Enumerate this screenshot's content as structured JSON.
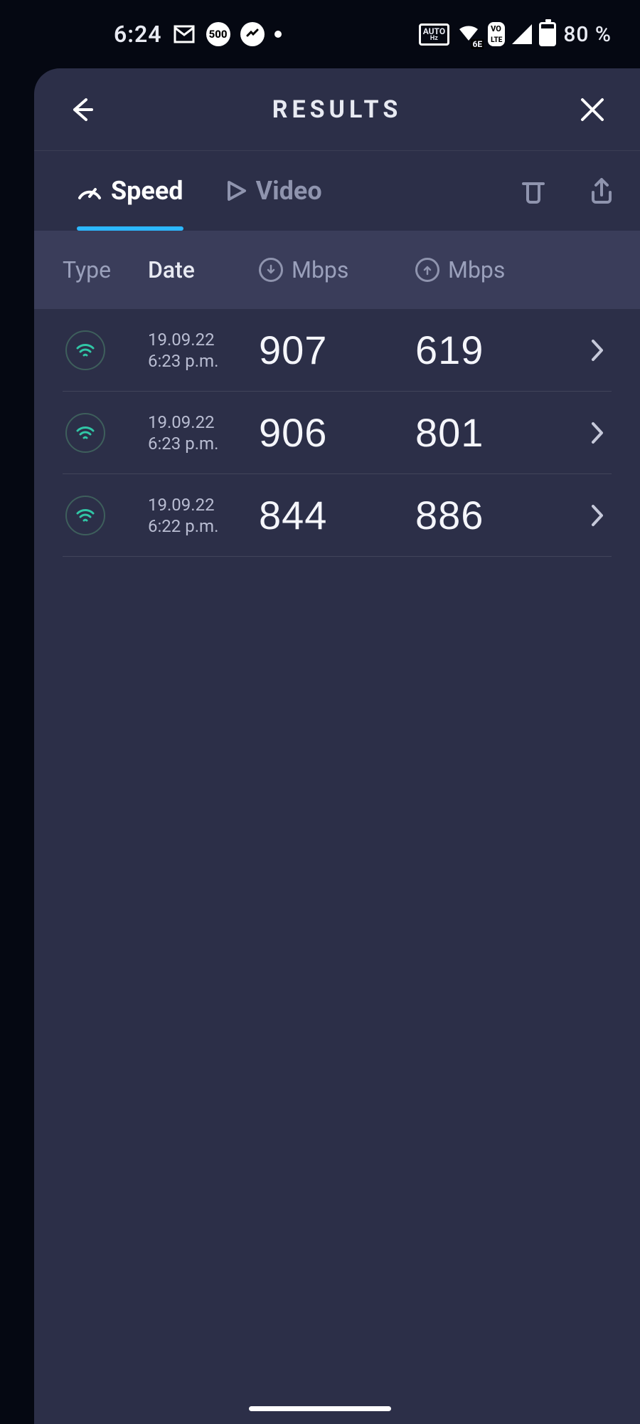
{
  "status_bar": {
    "time": "6:24",
    "icons": {
      "gmail": "M",
      "app_pill": "500",
      "messenger": "messenger",
      "notification_dot": true,
      "auto_hz_top": "AUTO",
      "auto_hz_bottom": "Hz",
      "wifi6e": "6E",
      "volte": "LTE"
    },
    "battery_percent": "80 %"
  },
  "header": {
    "title": "RESULTS"
  },
  "tabs": {
    "speed": "Speed",
    "video": "Video"
  },
  "columns": {
    "type": "Type",
    "date": "Date",
    "down_unit": "Mbps",
    "up_unit": "Mbps"
  },
  "results": [
    {
      "date": "19.09.22",
      "time": "6:23 p.m.",
      "download": "907",
      "upload": "619"
    },
    {
      "date": "19.09.22",
      "time": "6:23 p.m.",
      "download": "906",
      "upload": "801"
    },
    {
      "date": "19.09.22",
      "time": "6:22 p.m.",
      "download": "844",
      "upload": "886"
    }
  ]
}
